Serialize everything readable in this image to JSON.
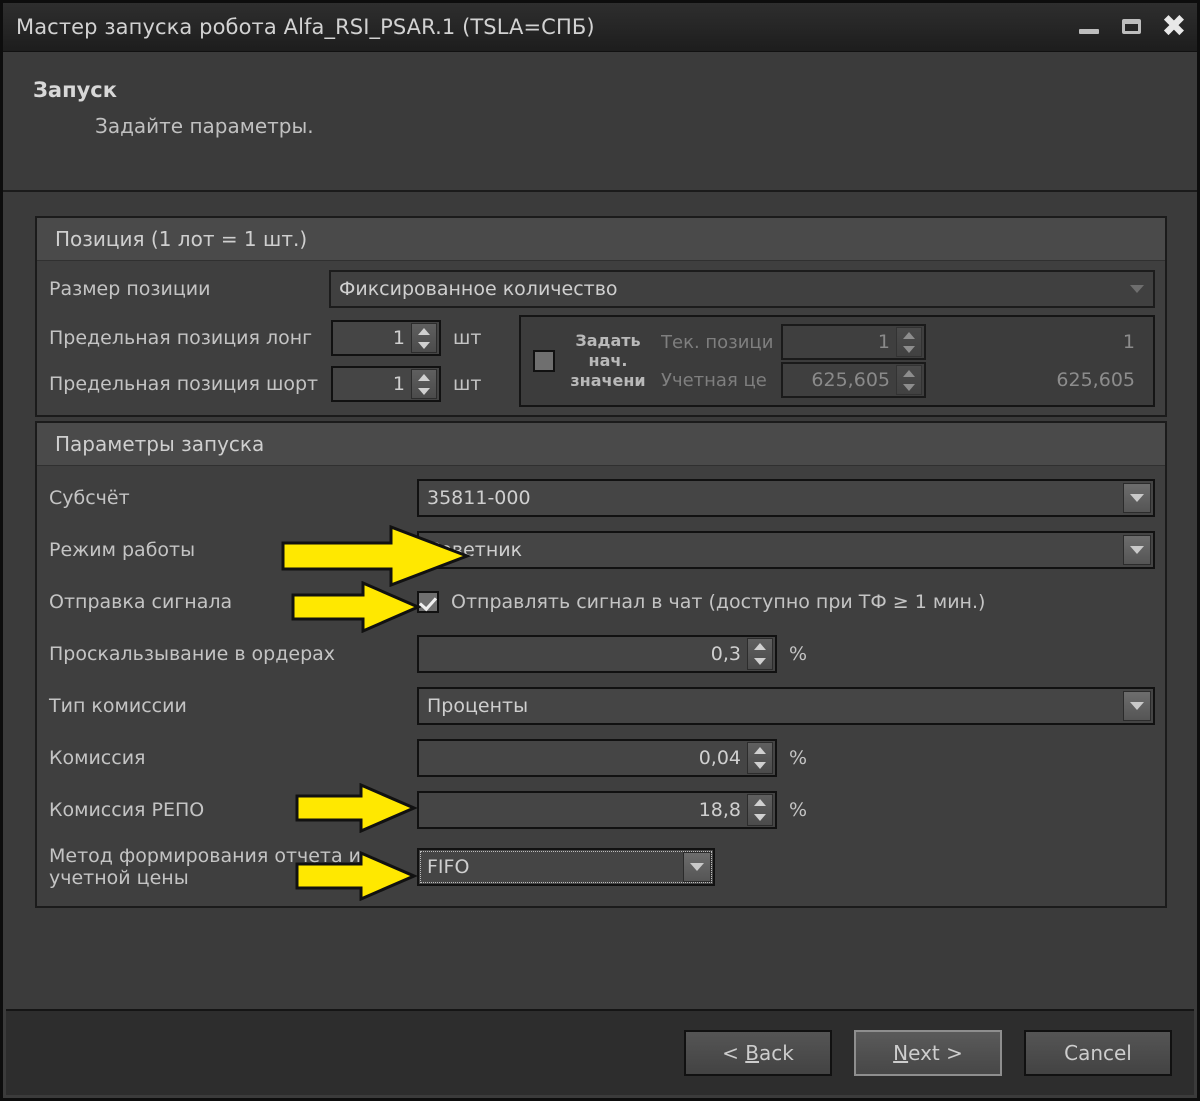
{
  "window": {
    "title": "Мастер запуска робота Alfa_RSI_PSAR.1 (TSLA=СПБ)",
    "controls": {
      "minimize": "minimize-icon",
      "maximize": "maximize-icon",
      "close": "✖"
    }
  },
  "header": {
    "title": "Запуск",
    "subtitle": "Задайте параметры."
  },
  "position_group": {
    "header": "Позиция (1 лот = 1 шт.)",
    "size_label": "Размер позиции",
    "size_value": "Фиксированное количество",
    "long_label": "Предельная позиция лонг",
    "long_value": "1",
    "long_unit": "шт",
    "short_label": "Предельная позиция шорт",
    "short_value": "1",
    "short_unit": "шт",
    "init_checkbox_label": "Задать нач. значени",
    "init_checked": false,
    "cur_pos_label": "Тек. позици",
    "cur_pos_value": "1",
    "cur_pos_echo": "1",
    "acct_price_label": "Учетная це",
    "acct_price_value": "625,605",
    "acct_price_echo": "625,605"
  },
  "launch_group": {
    "header": "Параметры запуска",
    "subaccount_label": "Субсчёт",
    "subaccount_value": "35811-000",
    "mode_label": "Режим работы",
    "mode_value": "Советник",
    "signal_label": "Отправка сигнала",
    "signal_checkbox_label": "Отправлять сигнал в чат (доступно при ТФ ≥ 1 мин.)",
    "signal_checked": true,
    "slippage_label": "Проскальзывание в ордерах",
    "slippage_value": "0,3",
    "slippage_unit": "%",
    "commission_type_label": "Тип комиссии",
    "commission_type_value": "Проценты",
    "commission_label": "Комиссия",
    "commission_value": "0,04",
    "commission_unit": "%",
    "repo_label": "Комиссия РЕПО",
    "repo_value": "18,8",
    "repo_unit": "%",
    "method_label_line1": "Метод формирования отчета и",
    "method_label_line2": "учетной цены",
    "method_value": "FIFO"
  },
  "footer": {
    "back": "< Back",
    "back_mnemonic": "B",
    "next": "Next >",
    "next_mnemonic": "N",
    "cancel": "Cancel"
  },
  "annotations": {
    "arrow_color": "#FFE800",
    "arrow_count": 4
  }
}
